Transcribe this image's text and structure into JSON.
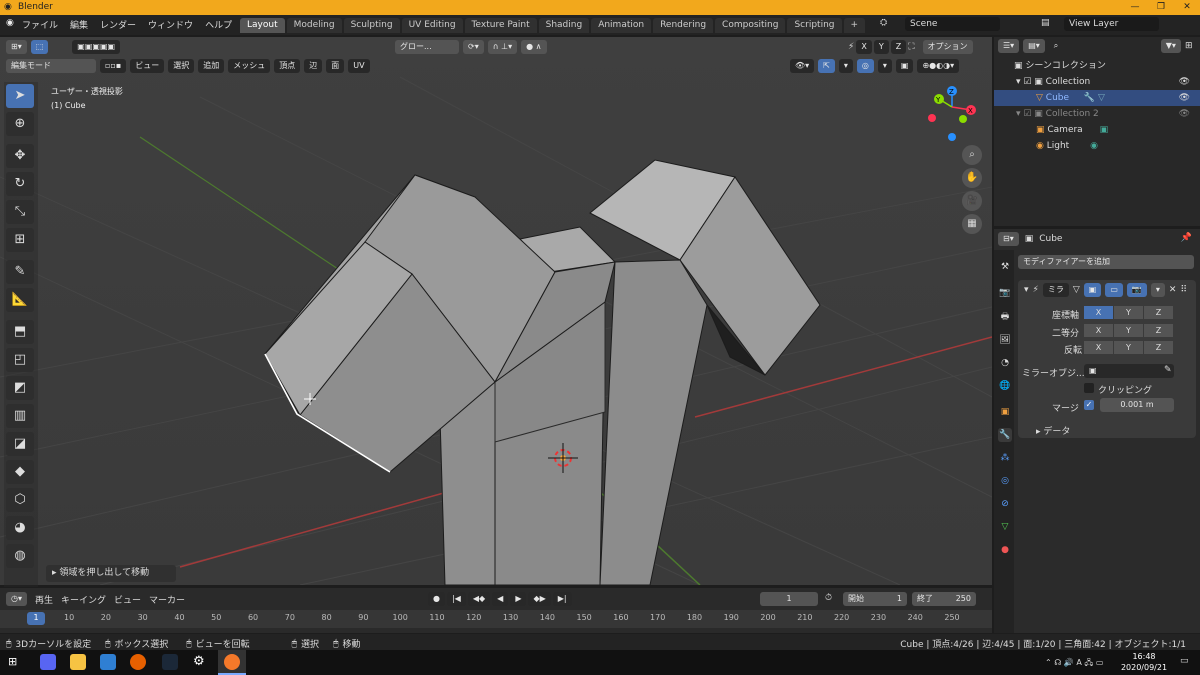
{
  "window": {
    "title": "Blender",
    "min": "—",
    "max": "❐",
    "close": "✕"
  },
  "menu": [
    "ファイル",
    "編集",
    "レンダー",
    "ウィンドウ",
    "ヘルプ"
  ],
  "workspaces": [
    "Layout",
    "Modeling",
    "Sculpting",
    "UV Editing",
    "Texture Paint",
    "Shading",
    "Animation",
    "Rendering",
    "Compositing",
    "Scripting",
    "+"
  ],
  "scene": "Scene",
  "view_layer": "View Layer",
  "viewport": {
    "transform_orientation": "グロー...",
    "mode": "編集モード",
    "header_menus": [
      "ビュー",
      "選択",
      "追加",
      "メッシュ",
      "頂点",
      "辺",
      "面",
      "UV"
    ],
    "axes": [
      "X",
      "Y",
      "Z"
    ],
    "options": "オプション",
    "view_name": "ユーザー・透視投影",
    "object_name": "(1) Cube",
    "operator_panel": "領域を押し出して移動",
    "gizmo_labels": [
      "Z",
      "Y",
      "X"
    ]
  },
  "outliner": {
    "title": "シーンコレクション",
    "rows": [
      {
        "label": "Collection"
      },
      {
        "label": "Cube"
      },
      {
        "label": "Collection 2"
      },
      {
        "label": "Camera"
      },
      {
        "label": "Light"
      }
    ]
  },
  "properties": {
    "object": "Cube",
    "add_modifier": "モディファイアーを追加",
    "modifier_name": "ミラ",
    "axis_label": "座標軸",
    "bisect_label": "二等分",
    "flip_label": "反転",
    "mirror_object_label": "ミラーオブジ...",
    "clipping_label": "クリッピング",
    "merge_label": "マージ",
    "merge_value": "0.001 m",
    "data_label": "データ"
  },
  "timeline": {
    "menus": [
      "再生",
      "キーイング",
      "ビュー",
      "マーカー"
    ],
    "current_frame": "1",
    "start_label": "開始",
    "start": "1",
    "end_label": "終了",
    "end": "250",
    "ticks": [
      "1",
      "10",
      "20",
      "30",
      "40",
      "50",
      "60",
      "70",
      "80",
      "90",
      "100",
      "110",
      "120",
      "130",
      "140",
      "150",
      "160",
      "170",
      "180",
      "190",
      "200",
      "210",
      "220",
      "230",
      "240",
      "250"
    ]
  },
  "status": {
    "left": [
      "3Dカーソルを設定",
      "ボックス選択",
      "ビューを回転",
      "選択",
      "移動"
    ],
    "right": "Cube | 頂点:4/26 | 辺:4/45 | 面:1/20 | 三角面:42 | オブジェクト:1/1"
  },
  "taskbar": {
    "time": "16:48",
    "date": "2020/09/21"
  },
  "colors": {
    "accent": "#4772b3",
    "titlebar": "#f2a81c",
    "x_axis": "#ff3352",
    "y_axis": "#8bdc00",
    "z_axis": "#2890ff"
  }
}
